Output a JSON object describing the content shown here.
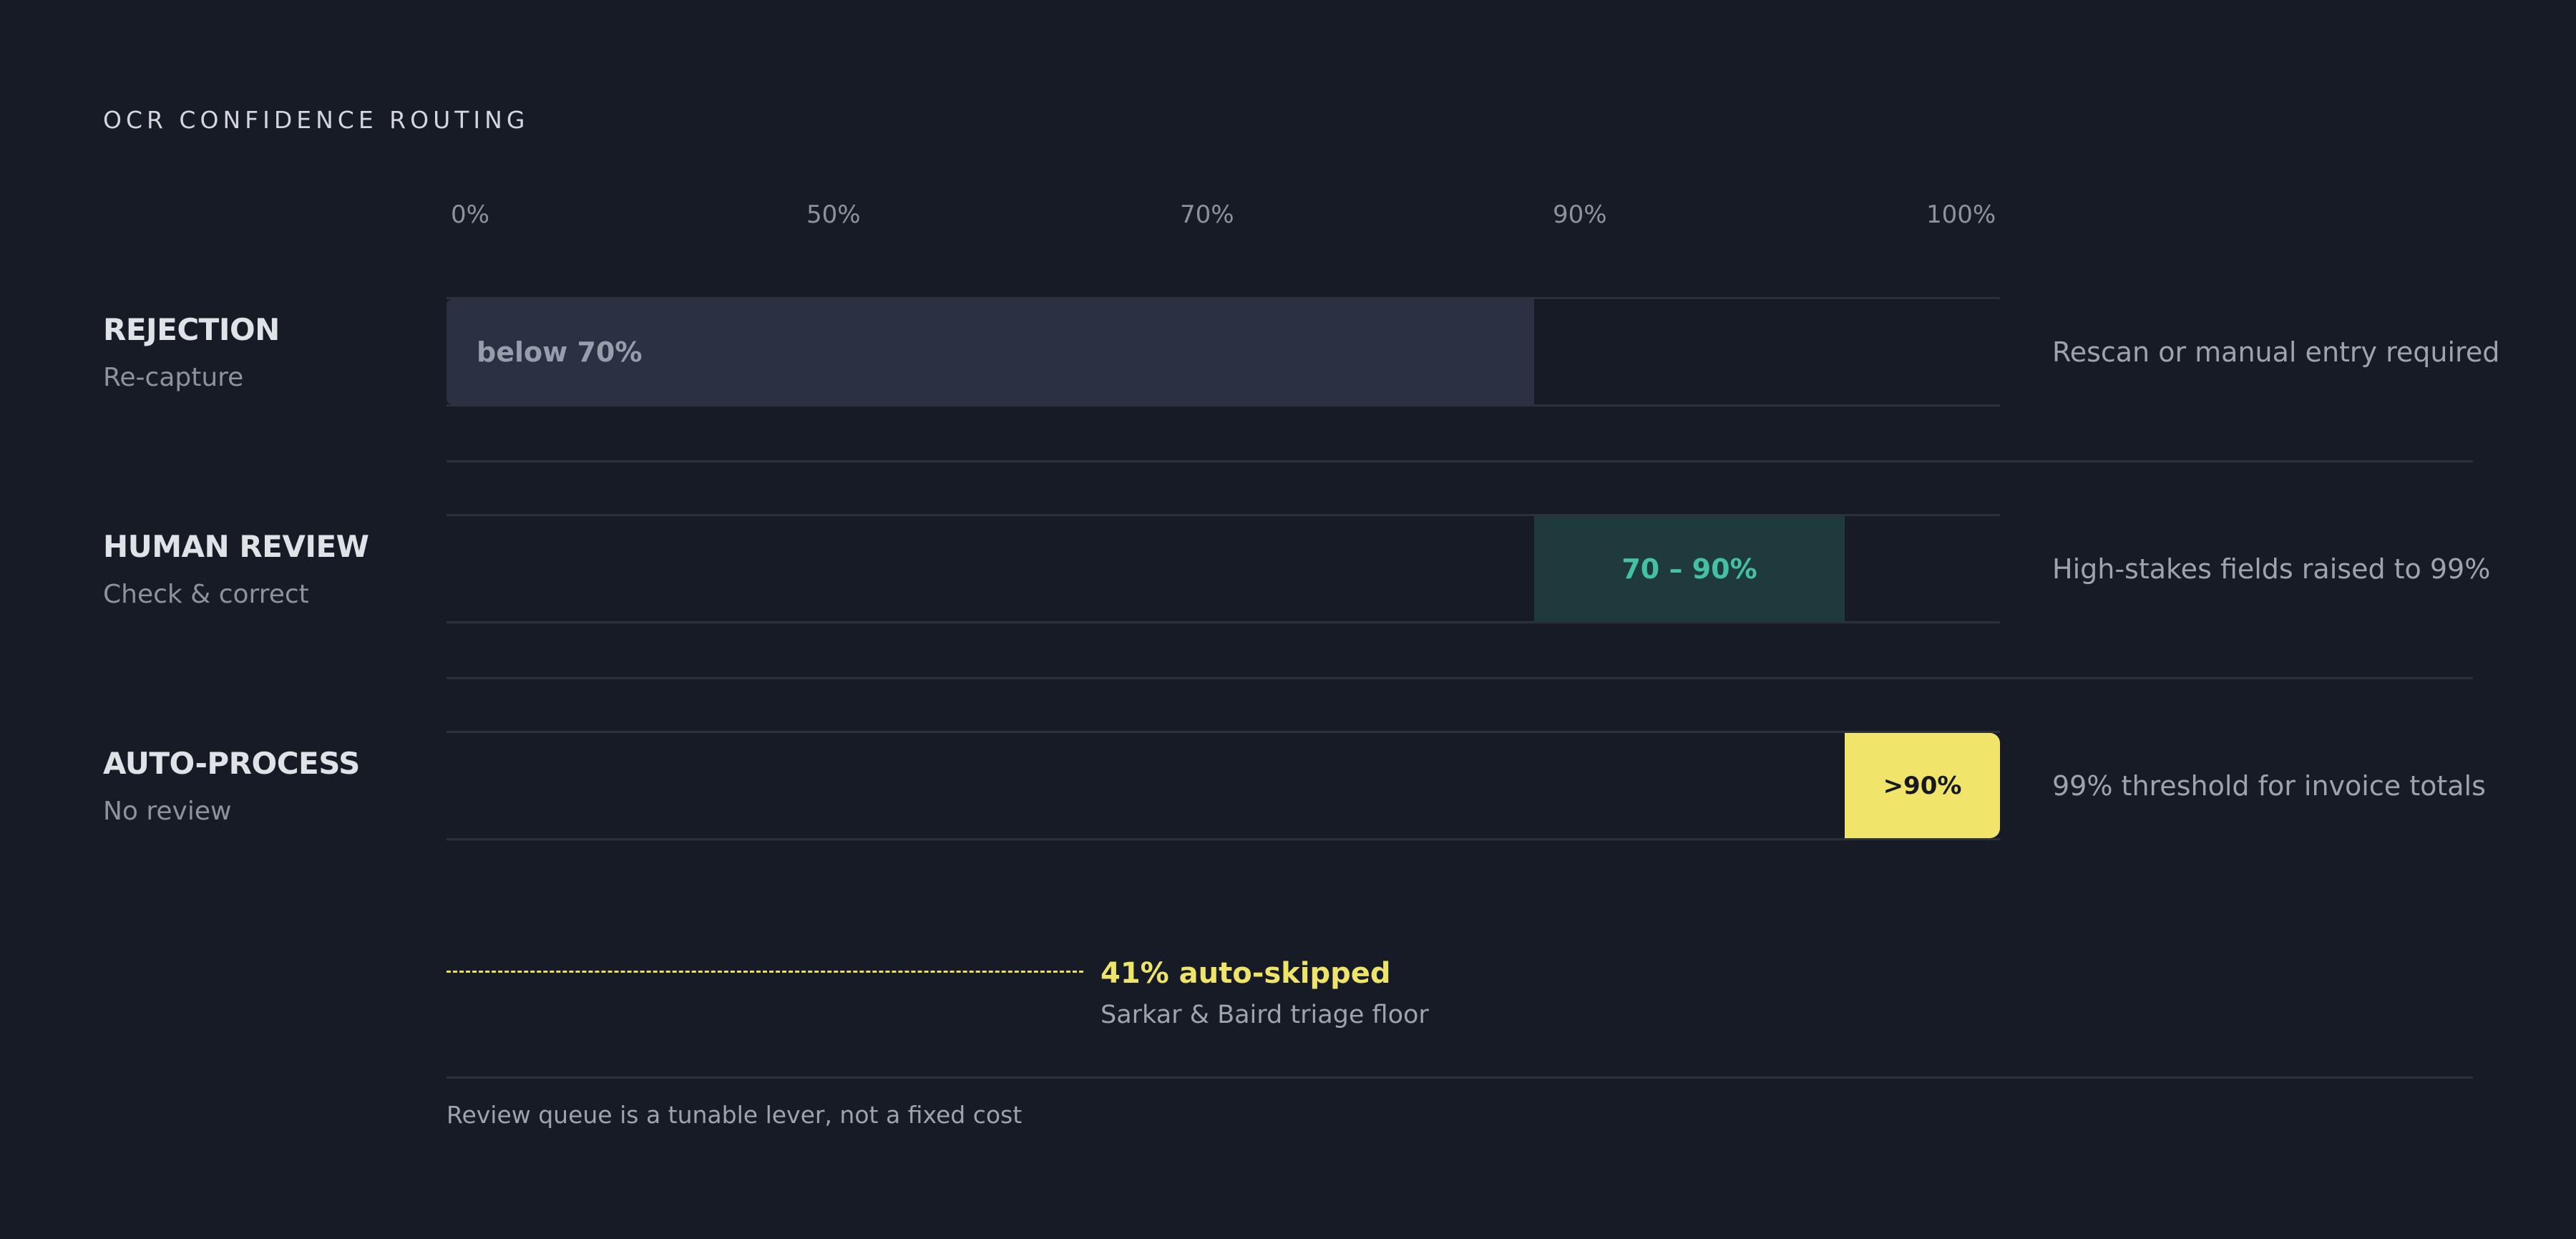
{
  "header": {
    "eyebrow": "OCR CONFIDENCE ROUTING"
  },
  "scale": {
    "ticks": [
      "0%",
      "50%",
      "70%",
      "90%",
      "100%"
    ]
  },
  "rows": [
    {
      "title": "REJECTION",
      "subtitle": "Re-capture",
      "band_label": "below 70%",
      "note": "Rescan or manual entry required",
      "color": "#2b3142"
    },
    {
      "title": "HUMAN REVIEW",
      "subtitle": "Check & correct",
      "band_label": "70 – 90%",
      "note": "High-stakes fields raised to 99%",
      "color": "#1f3a3c"
    },
    {
      "title": "AUTO-PROCESS",
      "subtitle": "No review",
      "band_label": ">90%",
      "note": "99% threshold for invoice totals",
      "color": "#f0e56a"
    }
  ],
  "stat": {
    "headline": "41% auto-skipped",
    "caption": "Sarkar & Baird triage floor"
  },
  "footer": {
    "note": "Review queue is a tunable lever, not a fixed cost"
  },
  "colors": {
    "background": "#161b25",
    "accent_yellow": "#f0e56a",
    "accent_teal": "#45c0a1",
    "muted_text": "#8d929c"
  }
}
